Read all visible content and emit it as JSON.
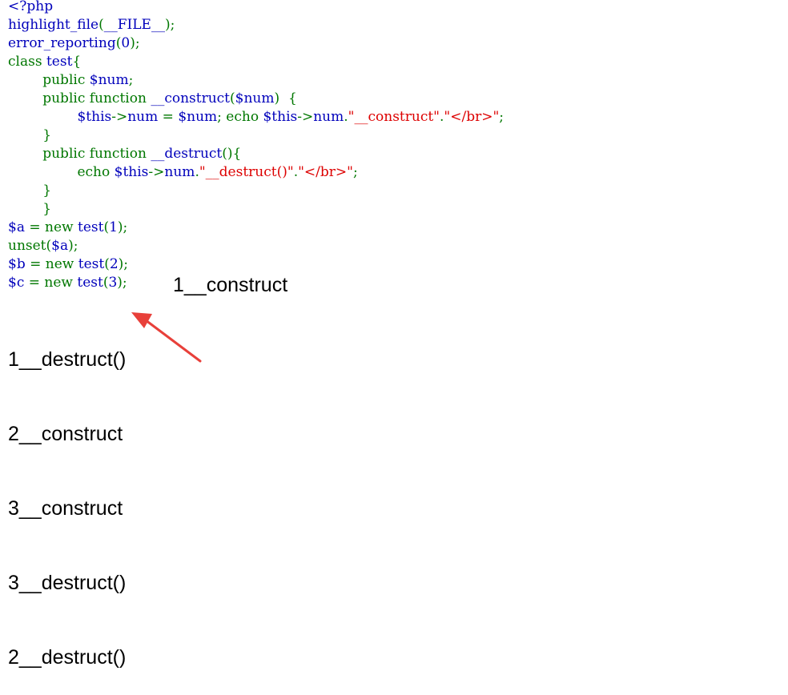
{
  "colors": {
    "default": "#0000BB",
    "keyword": "#007700",
    "string": "#DD0000",
    "html": "#000000",
    "arrow": "#e8403a"
  },
  "code_lines": [
    {
      "tokens": [
        {
          "t": "<?php",
          "c": "default"
        }
      ]
    },
    {
      "tokens": [
        {
          "t": "highlight_file",
          "c": "default"
        },
        {
          "t": "(",
          "c": "keyword"
        },
        {
          "t": "__FILE__",
          "c": "default"
        },
        {
          "t": ");",
          "c": "keyword"
        }
      ]
    },
    {
      "tokens": [
        {
          "t": "error_reporting",
          "c": "default"
        },
        {
          "t": "(",
          "c": "keyword"
        },
        {
          "t": "0",
          "c": "default"
        },
        {
          "t": ");",
          "c": "keyword"
        }
      ]
    },
    {
      "tokens": [
        {
          "t": "class ",
          "c": "keyword"
        },
        {
          "t": "test",
          "c": "default"
        },
        {
          "t": "{",
          "c": "keyword"
        }
      ]
    },
    {
      "tokens": [
        {
          "t": "        public ",
          "c": "keyword"
        },
        {
          "t": "$num",
          "c": "default"
        },
        {
          "t": ";",
          "c": "keyword"
        }
      ]
    },
    {
      "tokens": [
        {
          "t": "        public function ",
          "c": "keyword"
        },
        {
          "t": "__construct",
          "c": "default"
        },
        {
          "t": "(",
          "c": "keyword"
        },
        {
          "t": "$num",
          "c": "default"
        },
        {
          "t": ")  {",
          "c": "keyword"
        }
      ]
    },
    {
      "tokens": [
        {
          "t": "                ",
          "c": "keyword"
        },
        {
          "t": "$this",
          "c": "default"
        },
        {
          "t": "->",
          "c": "keyword"
        },
        {
          "t": "num ",
          "c": "default"
        },
        {
          "t": "= ",
          "c": "keyword"
        },
        {
          "t": "$num",
          "c": "default"
        },
        {
          "t": "; echo ",
          "c": "keyword"
        },
        {
          "t": "$this",
          "c": "default"
        },
        {
          "t": "->",
          "c": "keyword"
        },
        {
          "t": "num",
          "c": "default"
        },
        {
          "t": ".",
          "c": "keyword"
        },
        {
          "t": "\"__construct\"",
          "c": "string"
        },
        {
          "t": ".",
          "c": "keyword"
        },
        {
          "t": "\"</br>\"",
          "c": "string"
        },
        {
          "t": ";",
          "c": "keyword"
        }
      ]
    },
    {
      "tokens": [
        {
          "t": "        }",
          "c": "keyword"
        }
      ]
    },
    {
      "tokens": [
        {
          "t": "        public function ",
          "c": "keyword"
        },
        {
          "t": "__destruct",
          "c": "default"
        },
        {
          "t": "(){",
          "c": "keyword"
        }
      ]
    },
    {
      "tokens": [
        {
          "t": "                echo ",
          "c": "keyword"
        },
        {
          "t": "$this",
          "c": "default"
        },
        {
          "t": "->",
          "c": "keyword"
        },
        {
          "t": "num",
          "c": "default"
        },
        {
          "t": ".",
          "c": "keyword"
        },
        {
          "t": "\"__destruct()\"",
          "c": "string"
        },
        {
          "t": ".",
          "c": "keyword"
        },
        {
          "t": "\"</br>\"",
          "c": "string"
        },
        {
          "t": ";",
          "c": "keyword"
        }
      ]
    },
    {
      "tokens": [
        {
          "t": "        }",
          "c": "keyword"
        }
      ]
    },
    {
      "tokens": [
        {
          "t": "        }",
          "c": "keyword"
        }
      ]
    },
    {
      "tokens": [
        {
          "t": "$a ",
          "c": "default"
        },
        {
          "t": "= new ",
          "c": "keyword"
        },
        {
          "t": "test",
          "c": "default"
        },
        {
          "t": "(",
          "c": "keyword"
        },
        {
          "t": "1",
          "c": "default"
        },
        {
          "t": ");",
          "c": "keyword"
        }
      ]
    },
    {
      "tokens": [
        {
          "t": "unset",
          "c": "keyword"
        },
        {
          "t": "(",
          "c": "keyword"
        },
        {
          "t": "$a",
          "c": "default"
        },
        {
          "t": ");",
          "c": "keyword"
        }
      ]
    },
    {
      "tokens": [
        {
          "t": "$b ",
          "c": "default"
        },
        {
          "t": "= new ",
          "c": "keyword"
        },
        {
          "t": "test",
          "c": "default"
        },
        {
          "t": "(",
          "c": "keyword"
        },
        {
          "t": "2",
          "c": "default"
        },
        {
          "t": ");",
          "c": "keyword"
        }
      ]
    },
    {
      "tokens": [
        {
          "t": "$c ",
          "c": "default"
        },
        {
          "t": "= new ",
          "c": "keyword"
        },
        {
          "t": "test",
          "c": "default"
        },
        {
          "t": "(",
          "c": "keyword"
        },
        {
          "t": "3",
          "c": "default"
        },
        {
          "t": ");",
          "c": "keyword"
        }
      ]
    }
  ],
  "output": {
    "inline": "1__construct",
    "lines": [
      "1__destruct()",
      "2__construct",
      "3__construct",
      "3__destruct()",
      "2__destruct()"
    ]
  },
  "annotation": {
    "icon": "red-arrow-icon"
  }
}
